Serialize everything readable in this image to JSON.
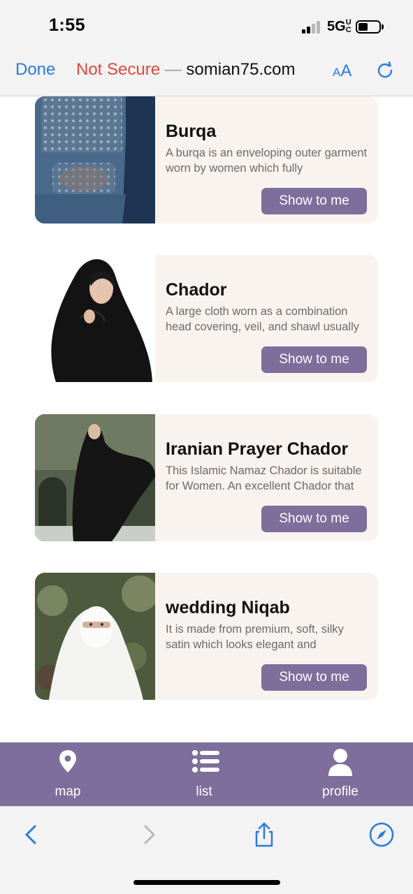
{
  "status_bar": {
    "time": "1:55",
    "network": "5G",
    "network_suffix": "UC",
    "signal_bars_filled": 2,
    "signal_bars_total": 4,
    "battery_level": 0.3
  },
  "browser": {
    "done_label": "Done",
    "not_secure_label": "Not Secure",
    "separator": "—",
    "domain": "somian75.com",
    "text_size_label": "AA",
    "reload_icon": "reload-icon",
    "accent_color": "#2a7ae2",
    "warning_color": "#e0483f"
  },
  "items": [
    {
      "title": "Burqa",
      "description": "A burqa is an enveloping outer garment worn by women which fully",
      "button_label": "Show to me",
      "image": "woman-in-blue-burqa-photo"
    },
    {
      "title": "Chador",
      "description": "A large cloth worn as a combination head covering, veil, and shawl usually",
      "button_label": "Show to me",
      "image": "woman-in-black-chador-photo"
    },
    {
      "title": "Iranian Prayer Chador",
      "description": "This Islamic Namaz Chador is suitable for Women. An excellent Chador that",
      "button_label": "Show to me",
      "image": "woman-in-flowing-chador-outdoors-photo"
    },
    {
      "title": "wedding Niqab",
      "description": "It is made from premium, soft, silky satin which looks elegant and",
      "button_label": "Show to me",
      "image": "woman-in-white-niqab-photo"
    }
  ],
  "app_nav": {
    "color": "#7d6e9b",
    "items": [
      {
        "label": "map",
        "icon": "map-pin-icon"
      },
      {
        "label": "list",
        "icon": "list-icon"
      },
      {
        "label": "profile",
        "icon": "person-icon"
      }
    ]
  },
  "toolbar": {
    "items": [
      "back-icon",
      "forward-icon",
      "share-icon",
      "compass-icon"
    ]
  }
}
